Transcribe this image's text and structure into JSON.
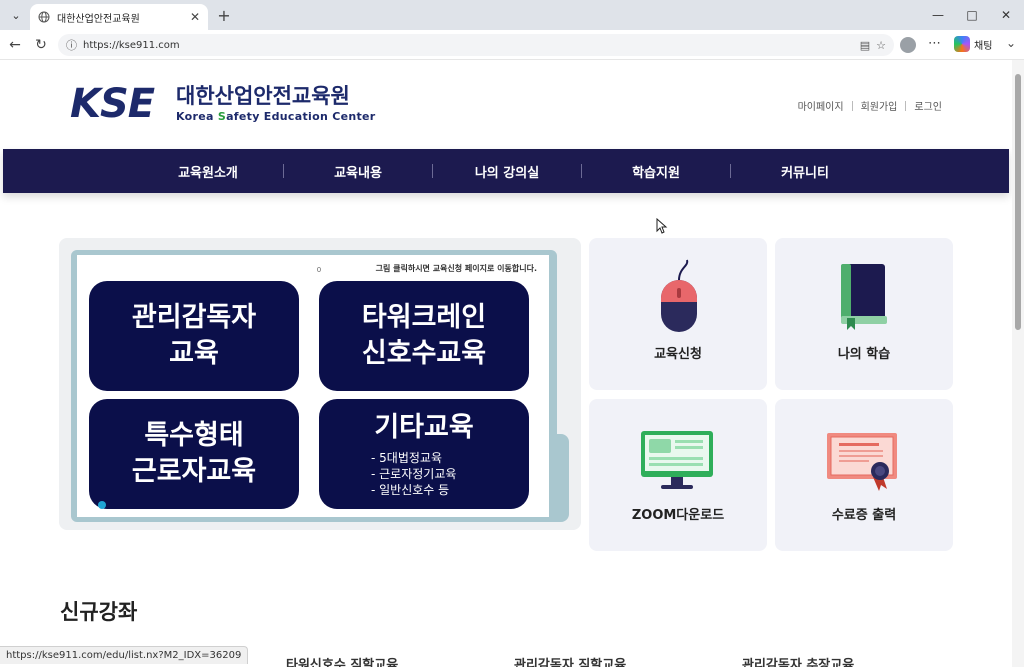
{
  "browser": {
    "tab_title": "대한산업안전교육원",
    "url": "https://kse911.com",
    "copilot_label": "채팅",
    "status_url": "https://kse911.com/edu/list.nx?M2_IDX=36209"
  },
  "header": {
    "logo_mark": "KSE",
    "logo_name_ko": "대한산업안전교육원",
    "logo_name_en_pre": "Korea ",
    "logo_name_en_s": "S",
    "logo_name_en_post": "afety Education Center",
    "top_links": [
      "마이페이지",
      "회원가입",
      "로그인"
    ]
  },
  "gnb": [
    "교육원소개",
    "교육내용",
    "나의 강의실",
    "학습지원",
    "커뮤니티"
  ],
  "banner": {
    "note": "그림 클릭하시면 교육신청 페이지로 이동합니다.",
    "page_indicator": "0",
    "cards": [
      {
        "line1": "관리감독자",
        "line2": "교육"
      },
      {
        "line1": "타워크레인",
        "line2": "신호수교육"
      },
      {
        "line1": "특수형태",
        "line2": "근로자교육"
      },
      {
        "line1": "기타교육",
        "items": [
          "- 5대법정교육",
          "- 근로자정기교육",
          "- 일반신호수 등"
        ]
      }
    ]
  },
  "quick_links": [
    {
      "label": "교육신청",
      "icon": "mouse-icon"
    },
    {
      "label": "나의 학습",
      "icon": "book-icon"
    },
    {
      "label": "ZOOM다운로드",
      "icon": "monitor-icon"
    },
    {
      "label": "수료증 출력",
      "icon": "certificate-icon"
    }
  ],
  "new_courses": {
    "title": "신규강좌",
    "items": [
      "타워신호수 직할교육",
      "관리감독자 직할교육",
      "관리감독자 추장교육"
    ]
  },
  "colors": {
    "navy": "#1c1a4f",
    "pill": "#0b0f4a",
    "logo_blue": "#1d2a6b",
    "logo_red": "#d6262c"
  }
}
